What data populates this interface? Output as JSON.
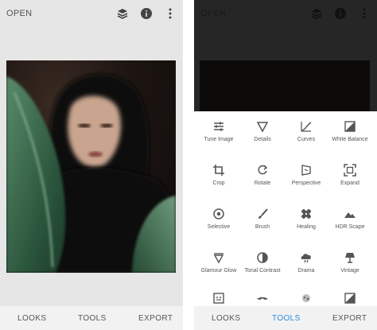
{
  "left": {
    "open_label": "OPEN",
    "nav": {
      "looks": "LOOKS",
      "tools": "TOOLS",
      "export": "EXPORT"
    }
  },
  "right": {
    "open_label": "OPEN",
    "nav": {
      "looks": "LOOKS",
      "tools": "TOOLS",
      "export": "EXPORT"
    },
    "active_tab": "TOOLS",
    "tools": [
      {
        "label": "Tune Image",
        "icon": "tune-image-icon"
      },
      {
        "label": "Details",
        "icon": "details-icon"
      },
      {
        "label": "Curves",
        "icon": "curves-icon"
      },
      {
        "label": "White Balance",
        "icon": "white-balance-icon"
      },
      {
        "label": "Crop",
        "icon": "crop-icon"
      },
      {
        "label": "Rotate",
        "icon": "rotate-icon"
      },
      {
        "label": "Perspective",
        "icon": "perspective-icon"
      },
      {
        "label": "Expand",
        "icon": "expand-icon"
      },
      {
        "label": "Selective",
        "icon": "selective-icon"
      },
      {
        "label": "Brush",
        "icon": "brush-icon"
      },
      {
        "label": "Healing",
        "icon": "healing-icon"
      },
      {
        "label": "HDR Scape",
        "icon": "hdr-scape-icon"
      },
      {
        "label": "Glamour Glow",
        "icon": "glamour-glow-icon"
      },
      {
        "label": "Tonal Contrast",
        "icon": "tonal-contrast-icon"
      },
      {
        "label": "Drama",
        "icon": "drama-icon"
      },
      {
        "label": "Vintage",
        "icon": "vintage-icon"
      }
    ]
  },
  "colors": {
    "accent": "#2a8adf",
    "sheet": "#ffffff",
    "topbar": "#e6e6e6"
  }
}
